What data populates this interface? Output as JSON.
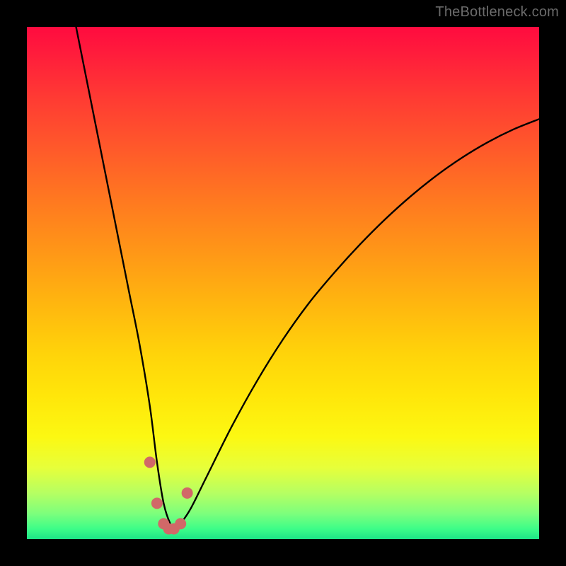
{
  "watermark": "TheBottleneck.com",
  "colors": {
    "frame": "#000000",
    "curve": "#000000",
    "marker": "#d16868"
  },
  "chart_data": {
    "type": "line",
    "title": "",
    "xlabel": "",
    "ylabel": "",
    "xlim": [
      0,
      100
    ],
    "ylim": [
      0,
      100
    ],
    "grid": false,
    "legend": false,
    "series": [
      {
        "name": "bottleneck-curve",
        "x": [
          9.6,
          12,
          14,
          16,
          18,
          20,
          22,
          24,
          25.4,
          26.7,
          28,
          29,
          30,
          32,
          35,
          40,
          45,
          50,
          55,
          60,
          65,
          70,
          75,
          80,
          85,
          90,
          95,
          100
        ],
        "values": [
          100,
          88,
          78,
          68,
          58,
          48,
          38,
          26,
          15,
          7,
          3,
          2,
          3,
          6,
          12,
          22,
          31,
          39,
          46,
          52,
          57.5,
          62.5,
          67,
          71,
          74.5,
          77.5,
          80,
          82
        ]
      }
    ],
    "markers": {
      "name": "highlight-points",
      "x": [
        24.0,
        25.4,
        26.7,
        27.7,
        28.7,
        30.0,
        31.3
      ],
      "values": [
        15.0,
        7.0,
        3.0,
        2.0,
        2.0,
        3.0,
        9.0
      ]
    }
  }
}
